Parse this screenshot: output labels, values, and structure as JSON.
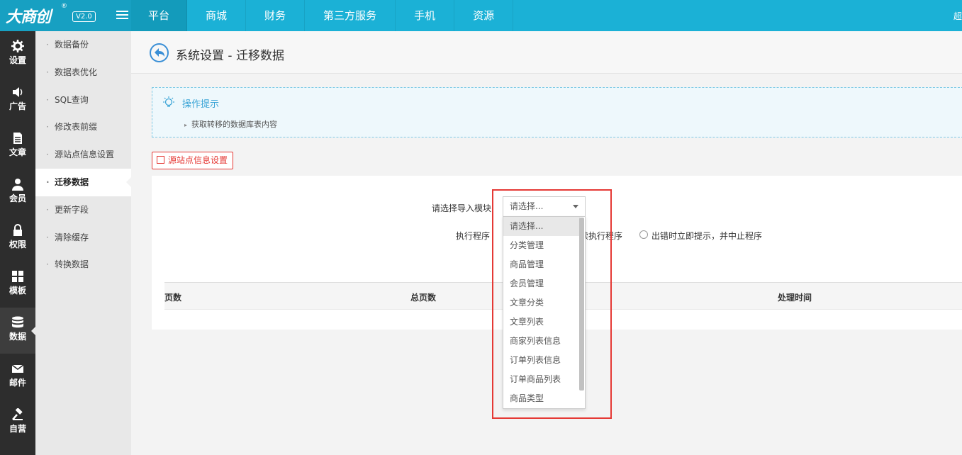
{
  "brand": {
    "logo": "大商创",
    "reg": "®",
    "version": "V2.0"
  },
  "topnav": [
    {
      "label": "平台",
      "active": true
    },
    {
      "label": "商城"
    },
    {
      "label": "财务"
    },
    {
      "label": "第三方服务"
    },
    {
      "label": "手机"
    },
    {
      "label": "资源"
    }
  ],
  "top_right": "超",
  "sidebar": [
    {
      "label": "设置",
      "icon": "gear-icon"
    },
    {
      "label": "广告",
      "icon": "speaker-icon"
    },
    {
      "label": "文章",
      "icon": "document-icon"
    },
    {
      "label": "会员",
      "icon": "user-icon"
    },
    {
      "label": "权限",
      "icon": "lock-icon"
    },
    {
      "label": "模板",
      "icon": "grid-icon"
    },
    {
      "label": "数据",
      "icon": "database-icon",
      "active": true
    },
    {
      "label": "邮件",
      "icon": "mail-icon"
    },
    {
      "label": "自营",
      "icon": "hammer-icon"
    }
  ],
  "submenu": [
    {
      "label": "数据备份"
    },
    {
      "label": "数据表优化"
    },
    {
      "label": "SQL查询"
    },
    {
      "label": "修改表前缀"
    },
    {
      "label": "源站点信息设置"
    },
    {
      "label": "迁移数据",
      "active": true
    },
    {
      "label": "更新字段"
    },
    {
      "label": "清除缓存"
    },
    {
      "label": "转换数据"
    }
  ],
  "page": {
    "title": "系统设置 - 迁移数据",
    "tips_title": "操作提示",
    "tips": [
      "获取转移的数据库表内容"
    ],
    "source_button": "源站点信息设置"
  },
  "form": {
    "module_label": "请选择导入模块",
    "module_value": "请选择...",
    "exec_label": "执行程序",
    "exec_option_1_visible": "续执行程序",
    "exec_option_2": "出错时立即提示，并中止程序"
  },
  "table": {
    "headers": [
      "页数",
      "总页数",
      "处理时间"
    ]
  },
  "dropdown_options": [
    "请选择...",
    "分类管理",
    "商品管理",
    "会员管理",
    "文章分类",
    "文章列表",
    "商家列表信息",
    "订单列表信息",
    "订单商品列表",
    "商品类型"
  ],
  "colors": {
    "topbar": "#1bb1d6",
    "sidebar": "#2d2d2d",
    "highlight": "#e53935",
    "accent_blue": "#3aa4d6"
  }
}
